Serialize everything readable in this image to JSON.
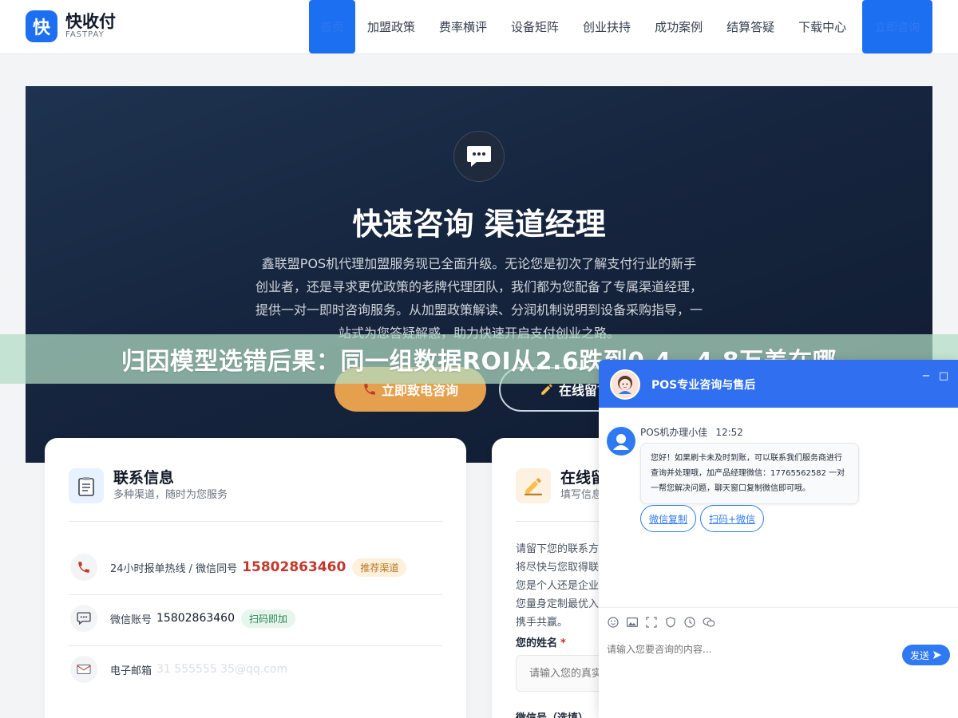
{
  "header": {
    "logo_mark": "快",
    "logo_name": "快收付",
    "logo_sub": "FASTPAY",
    "nav": [
      {
        "label": "首页"
      },
      {
        "label": "加盟政策"
      },
      {
        "label": "费率横评"
      },
      {
        "label": "设备矩阵"
      },
      {
        "label": "创业扶持"
      },
      {
        "label": "成功案例"
      },
      {
        "label": "结算答疑"
      },
      {
        "label": "下载中心"
      }
    ],
    "cta_label": "立即咨询"
  },
  "hero": {
    "title": "快速咨询 渠道经理",
    "description": "鑫联盟POS机代理加盟服务现已全面升级。无论您是初次了解支付行业的新手创业者，还是寻求更优政策的老牌代理团队，我们都为您配备了专属渠道经理，提供一对一即时咨询服务。从加盟政策解读、分润机制说明到设备采购指导，一站式为您答疑解惑，助力快速开启支付创业之路。",
    "call_button": "立即致电咨询",
    "message_button": "在线留言"
  },
  "banner": {
    "text": "归因模型选错后果：同一组数据ROI从2.6跌到0.4，4.8万差在哪"
  },
  "contact": {
    "title": "联系信息",
    "subtitle": "多种渠道，随时为您服务",
    "rows": [
      {
        "label": "24小时报单热线 / 微信同号",
        "value": "15802863460",
        "tag": "推荐渠道"
      },
      {
        "label": "微信账号",
        "value": "15802863460",
        "tag": "扫码即加"
      },
      {
        "label": "电子邮箱",
        "value": "31 555555 35@qq.com"
      }
    ]
  },
  "message": {
    "title": "在线留言",
    "subtitle": "填写信息",
    "description": "请留下您的联系方式，我们将尽快与您取得联系。无论您是个人还是企业，都将为您量身定制最优入驻方案，携手共赢。",
    "name_label": "您的姓名",
    "name_required": "*",
    "name_placeholder": "请输入您的真实姓名",
    "wechat_label": "微信号（选填）"
  },
  "chat": {
    "title": "POS专业咨询与售后",
    "agent_name": "POS机办理小佳",
    "time": "12:52",
    "message": "您好！如果刷卡未及时到账，可以联系我们服务商进行查询并处理哦，加产品经理微信：17765562582 一对一帮您解决问题，聊天窗口复制微信即可哦。",
    "chips": [
      "微信复制",
      "扫码+微信"
    ],
    "input_placeholder": "请输入您要咨询的内容...",
    "send_label": "发送",
    "minimize": "−",
    "maximize": "□"
  },
  "colors": {
    "brand": "#1d6ff2",
    "accent": "#e5a04e",
    "phone_number": "#c0392b"
  }
}
